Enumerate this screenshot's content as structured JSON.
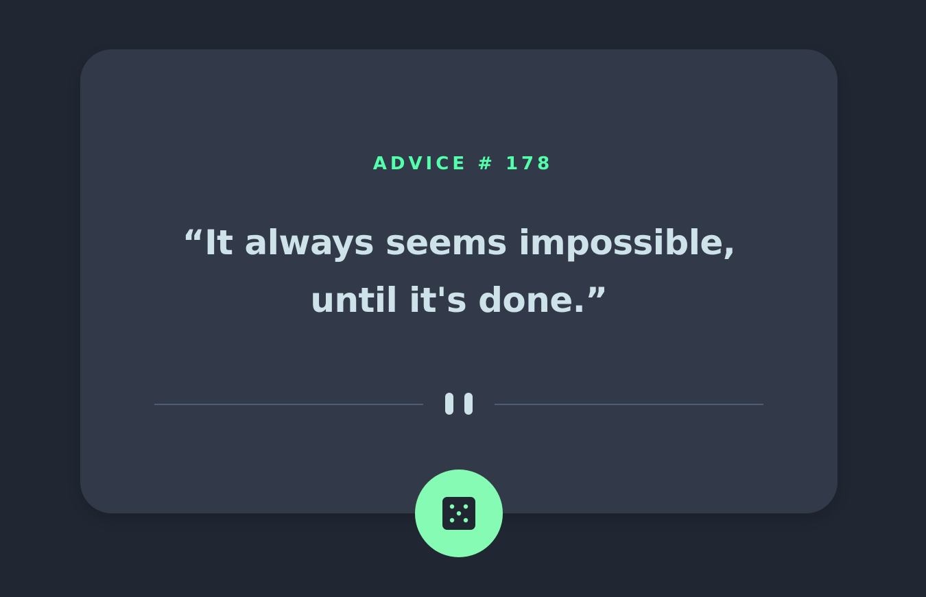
{
  "advice": {
    "label": "ADVICE # 178",
    "quote": "“It always seems impossible, until it's done.”"
  },
  "colors": {
    "background": "#202632",
    "card": "#323A49",
    "accent": "#53FFAA",
    "text": "#CEE3E9",
    "divider": "#4F5D74"
  },
  "icons": {
    "divider": "pause-icon",
    "button": "dice-icon"
  }
}
